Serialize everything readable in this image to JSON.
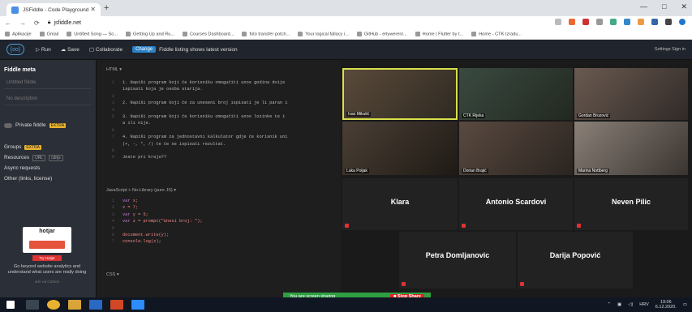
{
  "browser": {
    "tab_title": "JSFiddle - Code Playground",
    "new_tab": "+",
    "url": "jsfiddle.net",
    "bookmarks": [
      "Aplikacije",
      "Gmail",
      "Untitled Song — So...",
      "Getting Up and Ru...",
      "Courses Dashboard...",
      "foto transfer potch...",
      "Your logical fallacy i...",
      "GitHub - erlyweren/...",
      "Home | Flutter by t...",
      "Home - CTK Izradu..."
    ]
  },
  "fiddle_header": {
    "logo": "{oo}",
    "run": "Run",
    "save": "Save",
    "collaborate": "Collaborate",
    "change_badge": "Change",
    "status": "Fiddle listing shows latest version",
    "right": "Settings   Sign in"
  },
  "sidebar": {
    "title": "Fiddle meta",
    "name_placeholder": "Untitled fiddle",
    "description_placeholder": "No description",
    "private_label": "Private fiddle",
    "private_badge": "EXTRA",
    "groups_label": "Groups",
    "groups_badge": "EXTRA",
    "resources_label": "Resources",
    "resources_badges": [
      "URL",
      "cdnjs"
    ],
    "async_label": "Async requests",
    "other_label": "Other (links, license)",
    "ad": {
      "brand": "hotjar",
      "button": "Try Hotjar",
      "text": "Go beyond website analytics and understand what users are really doing",
      "carbon": "ads via Carbon"
    }
  },
  "editor": {
    "html_label": "HTML ▾",
    "html_lines": [
      {
        "num": "1",
        "text": "1. Napiši program koji će korisniku omogućiti unos godina dvije"
      },
      {
        "num": "",
        "text": "ispisati koja je osoba starija."
      },
      {
        "num": "2",
        "text": ""
      },
      {
        "num": "3",
        "text": "2. Napiši program koji će za uneseni broj ispisati je li paran i"
      },
      {
        "num": "4",
        "text": ""
      },
      {
        "num": "5",
        "text": "3. Napiši program koji će korisniku omogućiti unos lozinke te i"
      },
      {
        "num": "",
        "text": "a ili nije."
      },
      {
        "num": "6",
        "text": ""
      },
      {
        "num": "7",
        "text": "4. Napiši program za jednostavni kalkulator gdje će korisnik uni"
      },
      {
        "num": "",
        "text": "(+, -, *, /) te će se ispisati rezultat."
      },
      {
        "num": "8",
        "text": ""
      },
      {
        "num": "9",
        "text": "Jeste pri kraju??"
      }
    ],
    "js_label": "JavaScript + No-Library (pure JS) ▾",
    "js_lines": [
      {
        "num": "1",
        "kw": "var",
        "rest": " x;"
      },
      {
        "num": "2",
        "kw": "",
        "rest": "x = 7;"
      },
      {
        "num": "3",
        "kw": "var",
        "rest": " y = 5;"
      },
      {
        "num": "4",
        "kw": "var",
        "rest": " z = prompt(\"Unesi broj: \");"
      },
      {
        "num": "5",
        "kw": "",
        "rest": ""
      },
      {
        "num": "6",
        "kw": "",
        "rest": "document.write(y);"
      },
      {
        "num": "7",
        "kw": "",
        "rest": "console.log(z);"
      }
    ],
    "css_label": "CSS ▾"
  },
  "zoom": {
    "video_tiles": [
      {
        "name": "Ivan Mikulić"
      },
      {
        "name": "CTK Rijeka"
      },
      {
        "name": "Gordan Brozović"
      },
      {
        "name": "Luka Poljak"
      },
      {
        "name": "Dorian Brajić"
      },
      {
        "name": "Marina Nottberg"
      }
    ],
    "name_tiles": [
      "Klara",
      "Antonio Scardovi",
      "Neven Pilic",
      "Petra Domljanovic",
      "Darija Popović"
    ],
    "sharing_text": "You are screen sharing",
    "stop_label": "■ Stop Share"
  },
  "taskbar": {
    "language": "HRV",
    "time": "19:06",
    "date": "6.12.2020."
  }
}
